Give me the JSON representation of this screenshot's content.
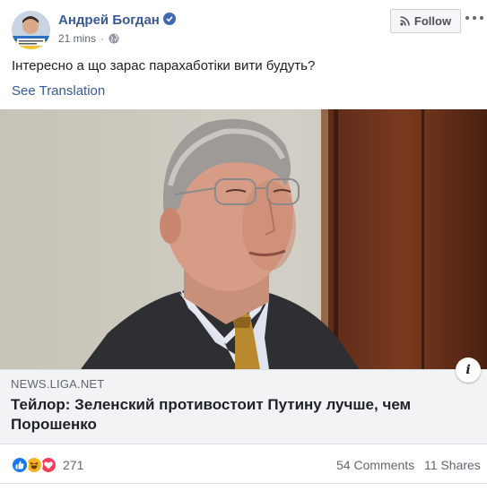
{
  "post": {
    "author": "Андрей Богдан",
    "time": "21 mins",
    "separator": "·",
    "follow_label": "Follow",
    "text": "Інтересно а що зарас парахаботіки вити будуть?",
    "see_translation": "See Translation"
  },
  "link_preview": {
    "domain": "NEWS.LIGA.NET",
    "headline": "Тейлор: Зеленский противостоит Путину лучше, чем Порошенко",
    "info_icon_glyph": "i"
  },
  "engagement": {
    "reactions": [
      "like-icon",
      "haha-icon",
      "love-icon"
    ],
    "reaction_count": "271",
    "comments": "54 Comments",
    "shares": "11 Shares"
  },
  "colors": {
    "link_blue": "#385898",
    "like_blue": "#1877f2",
    "haha_yellow": "#f7b125",
    "love_red": "#f33e58"
  }
}
